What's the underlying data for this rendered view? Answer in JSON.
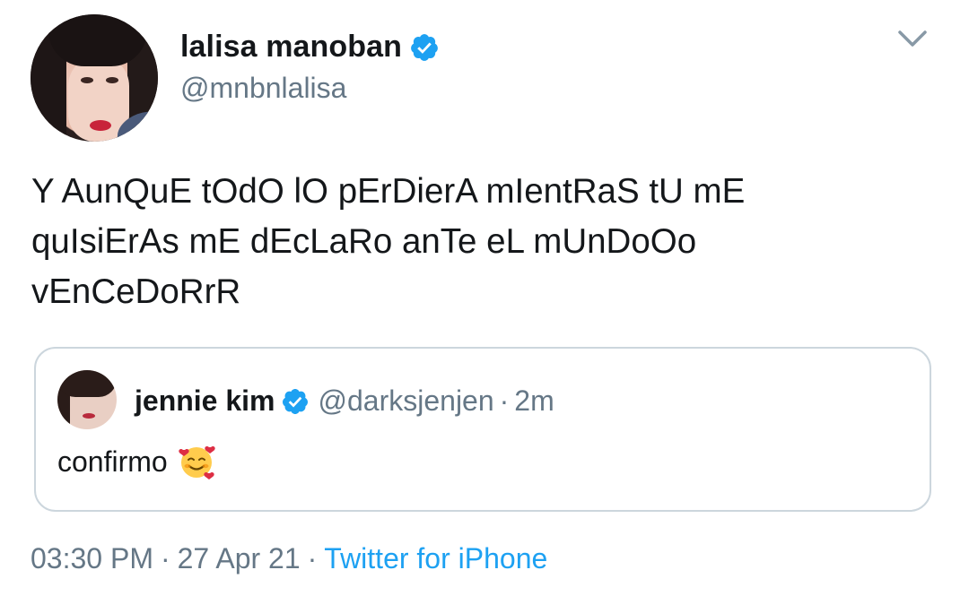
{
  "author": {
    "name": "lalisa manoban",
    "handle": "@mnbnlalisa",
    "verified": true
  },
  "tweet": {
    "text": "Y AunQuE tOdO lO pErDierA mIentRaS tU mE\nquIsiErAs mE dEcLaRo anTe eL mUnDoOo\nvEnCeDoRrR"
  },
  "quoted_tweet": {
    "name": "jennie kim",
    "handle": "@darksjenjen",
    "separator": "·",
    "time": "2m",
    "text": "confirmo",
    "emoji": "smiling-face-with-hearts"
  },
  "meta": {
    "time": "03:30 PM",
    "separator": "·",
    "date": "27 Apr 21",
    "source": "Twitter for iPhone"
  },
  "colors": {
    "text": "#14171a",
    "secondary": "#657786",
    "accent": "#1da1f2",
    "border": "#ccd6dd"
  },
  "icons": {
    "verified": "verified-badge-icon",
    "menu": "chevron-down-icon"
  }
}
